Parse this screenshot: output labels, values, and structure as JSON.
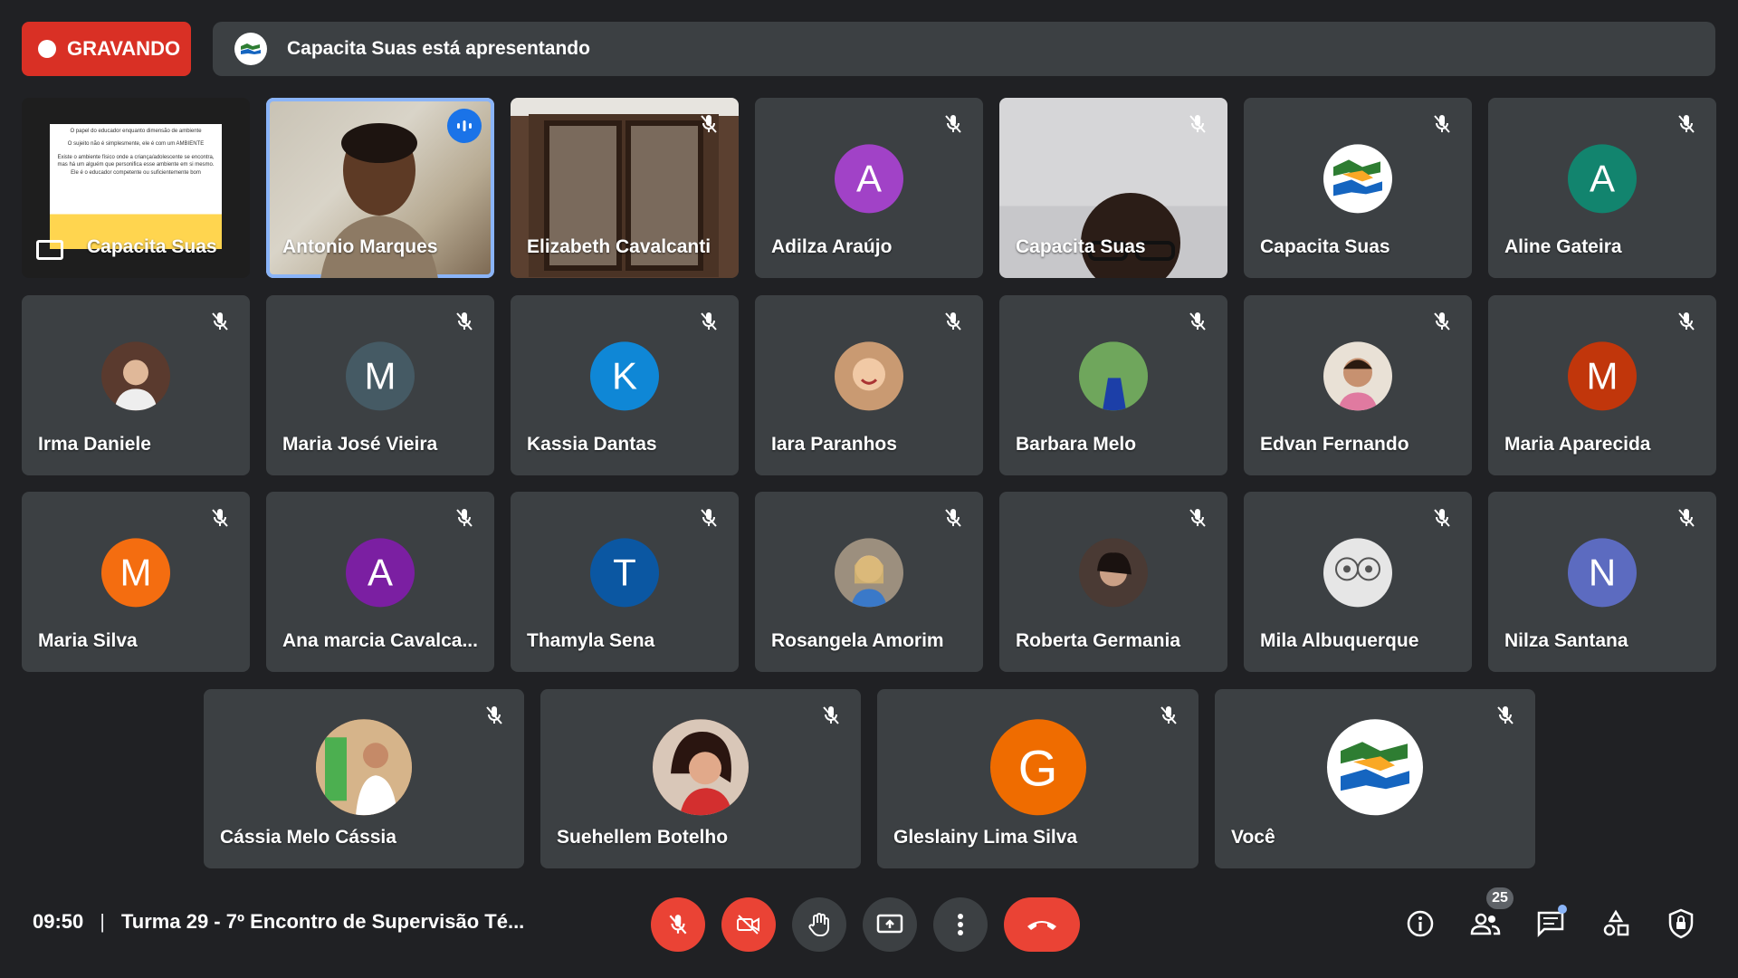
{
  "recording": {
    "label": "GRAVANDO",
    "color": "#d93025"
  },
  "presenting": {
    "text": "Capacita Suas está apresentando"
  },
  "slide": {
    "lines": [
      "O papel do educador enquanto dimensão de ambiente",
      "O sujeito não é simplesmente, ele é com um AMBIENTE",
      "Existe o ambiente físico onde a criança/adolescente se encontra, mas há um alguém que personifica esse ambiente em si mesmo. Ele é o educador competente ou suficientemente bom"
    ]
  },
  "tiles": [
    {
      "name": "Capacita Suas",
      "kind": "screen-share"
    },
    {
      "name": "Antonio Marques",
      "kind": "video",
      "speaking": true
    },
    {
      "name": "Elizabeth Cavalcanti",
      "kind": "video"
    },
    {
      "name": "Adilza Araújo",
      "initial": "A",
      "color": "#a142c7"
    },
    {
      "name": "Capacita Suas",
      "kind": "video"
    },
    {
      "name": "Capacita Suas",
      "kind": "logo"
    },
    {
      "name": "Aline Gateira",
      "initial": "A",
      "color": "#12846e"
    },
    {
      "name": "Irma Daniele",
      "kind": "photo",
      "photo": "#5a3a2e"
    },
    {
      "name": "Maria José Vieira",
      "initial": "M",
      "color": "#455a64"
    },
    {
      "name": "Kassia Dantas",
      "initial": "K",
      "color": "#0f87d6"
    },
    {
      "name": "Iara Paranhos",
      "kind": "photo",
      "photo": "#c99a72"
    },
    {
      "name": "Barbara Melo",
      "kind": "photo",
      "photo": "#3f7a3a"
    },
    {
      "name": "Edvan Fernando",
      "kind": "photo",
      "photo": "#b07a5a"
    },
    {
      "name": "Maria Aparecida",
      "initial": "M",
      "color": "#c1360b"
    },
    {
      "name": "Maria Silva",
      "initial": "M",
      "color": "#f46d10"
    },
    {
      "name": "Ana marcia Cavalca...",
      "initial": "A",
      "color": "#7b1fa2"
    },
    {
      "name": "Thamyla Sena",
      "initial": "T",
      "color": "#0b57a2"
    },
    {
      "name": "Rosangela Amorim",
      "kind": "photo",
      "photo": "#9c8f7e"
    },
    {
      "name": "Roberta Germania",
      "kind": "photo",
      "photo": "#4a3a34"
    },
    {
      "name": "Mila Albuquerque",
      "kind": "photo",
      "photo": "#d7d7d7"
    },
    {
      "name": "Nilza Santana",
      "initial": "N",
      "color": "#5c6bc0"
    },
    {
      "name": "Cássia Melo Cássia",
      "kind": "photo",
      "photo": "#c98b62"
    },
    {
      "name": "Suehellem Botelho",
      "kind": "photo",
      "photo": "#8d5a4a"
    },
    {
      "name": "Gleslainy Lima Silva",
      "initial": "G",
      "color": "#ef6c00"
    },
    {
      "name": "Você",
      "kind": "logo"
    }
  ],
  "logo_text": "Capacita SUAS/PE",
  "meeting": {
    "time": "09:50",
    "title": "Turma 29 - 7º Encontro de Supervisão Té..."
  },
  "participants_count": "25",
  "controls": [
    "mic-off",
    "camera-off",
    "raise-hand",
    "present",
    "more-options",
    "leave-call"
  ],
  "right_controls": [
    "meeting-details",
    "people",
    "chat",
    "activities",
    "host-controls"
  ]
}
